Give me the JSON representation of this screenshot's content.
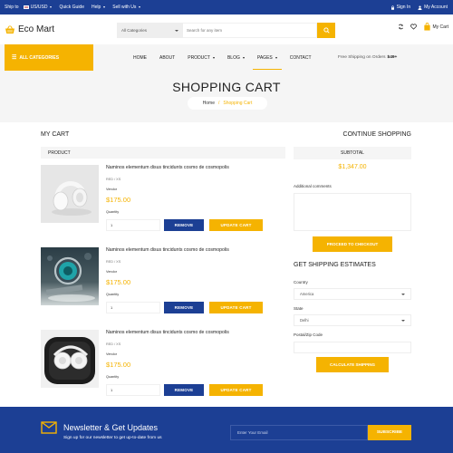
{
  "colors": {
    "primary_blue": "#1c3f94",
    "accent_yellow": "#f5b301",
    "light_gray": "#f5f5f5"
  },
  "topbar": {
    "ship_to": "Ship to",
    "currency": "US/USD",
    "quick_guide": "Quick Guide",
    "help": "Help",
    "sell": "Sell with Us",
    "sign_in": "Sign In",
    "account": "My Account"
  },
  "header": {
    "logo": "Eco Mart",
    "search_category": "All Categories",
    "search_placeholder": "Search for any item",
    "cart_label": "My Cart"
  },
  "nav": {
    "all_categories": "ALL CATEGORIES",
    "links": [
      "HOME",
      "ABOUT",
      "PRODUCT",
      "BLOG",
      "PAGES",
      "CONTACT"
    ],
    "free_shipping_text": "Free Shipping on Orders",
    "free_shipping_amount": "$49+"
  },
  "hero": {
    "title": "SHOPPING CART",
    "breadcrumb_home": "Home",
    "breadcrumb_sep": "/",
    "breadcrumb_current": "Shopping Cart"
  },
  "cart": {
    "title": "MY CART",
    "continue": "CONTINUE SHOPPING",
    "column_header": "PRODUCT",
    "items": [
      {
        "title": "Naminos elementum disus tincidunts cosmo de cosmopolis",
        "option": "RED / XS",
        "vendor": "Vendor",
        "price": "$175.00",
        "qty_label": "Quantity",
        "qty": "1",
        "remove": "REMOVE",
        "update": "UPDATE CART"
      },
      {
        "title": "Naminos elementum disus tincidunts cosmo de cosmopolis",
        "option": "RED / XS",
        "vendor": "Vendor",
        "price": "$175.00",
        "qty_label": "Quantity",
        "qty": "1",
        "remove": "REMOVE",
        "update": "UPDATE CART"
      },
      {
        "title": "Naminos elementum disus tincidunts cosmo de cosmopolis",
        "option": "RED / XS",
        "vendor": "Vendor",
        "price": "$175.00",
        "qty_label": "Quantity",
        "qty": "1",
        "remove": "REMOVE",
        "update": "UPDATE CART"
      }
    ]
  },
  "summary": {
    "subtotal_label": "SUBTOTAL",
    "subtotal_value": "$1,347.00",
    "comments_label": "Additional comments",
    "checkout": "PROCEED TO CHECKOUT",
    "shipping_title": "GET SHIPPING ESTIMATES",
    "country_label": "Country",
    "country_value": "America",
    "state_label": "State",
    "state_value": "Delhi",
    "zip_label": "Postal/Zip Code",
    "calculate": "CALCULATE SHIPPING"
  },
  "newsletter": {
    "title": "Newsletter & Get Updates",
    "subtitle": "Sign up for our newsletter to get up-to-date from us",
    "email_placeholder": "Enter Your Email",
    "subscribe": "SUBSCRIBE"
  }
}
